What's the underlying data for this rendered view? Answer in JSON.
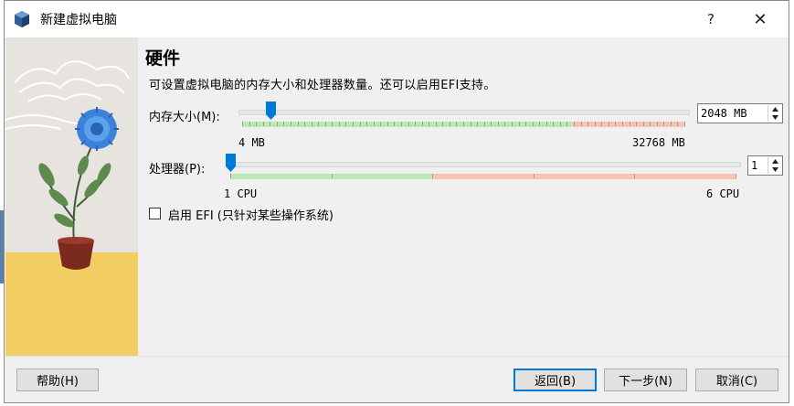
{
  "window": {
    "title": "新建虚拟电脑",
    "help_glyph": "?",
    "close_glyph": "✕"
  },
  "page": {
    "heading": "硬件",
    "description": "可设置虚拟电脑的内存大小和处理器数量。还可以启用EFI支持。"
  },
  "memory": {
    "label": "内存大小(M):",
    "value": "2048 MB",
    "min_label": "4 MB",
    "max_label": "32768 MB",
    "level_fraction": 0.062
  },
  "cpu": {
    "label": "处理器(P):",
    "value": "1",
    "min_label": "1 CPU",
    "max_label": "6 CPU",
    "level_fraction": 0.0
  },
  "efi": {
    "label": "启用 EFI (只针对某些操作系统)",
    "checked": false
  },
  "buttons": {
    "help": "帮助(H)",
    "back": "返回(B)",
    "next": "下一步(N)",
    "cancel": "取消(C)"
  },
  "colors": {
    "ok_zone": "#b8eab2",
    "warn_zone": "#f5c4b3",
    "accent": "#0078d7"
  }
}
